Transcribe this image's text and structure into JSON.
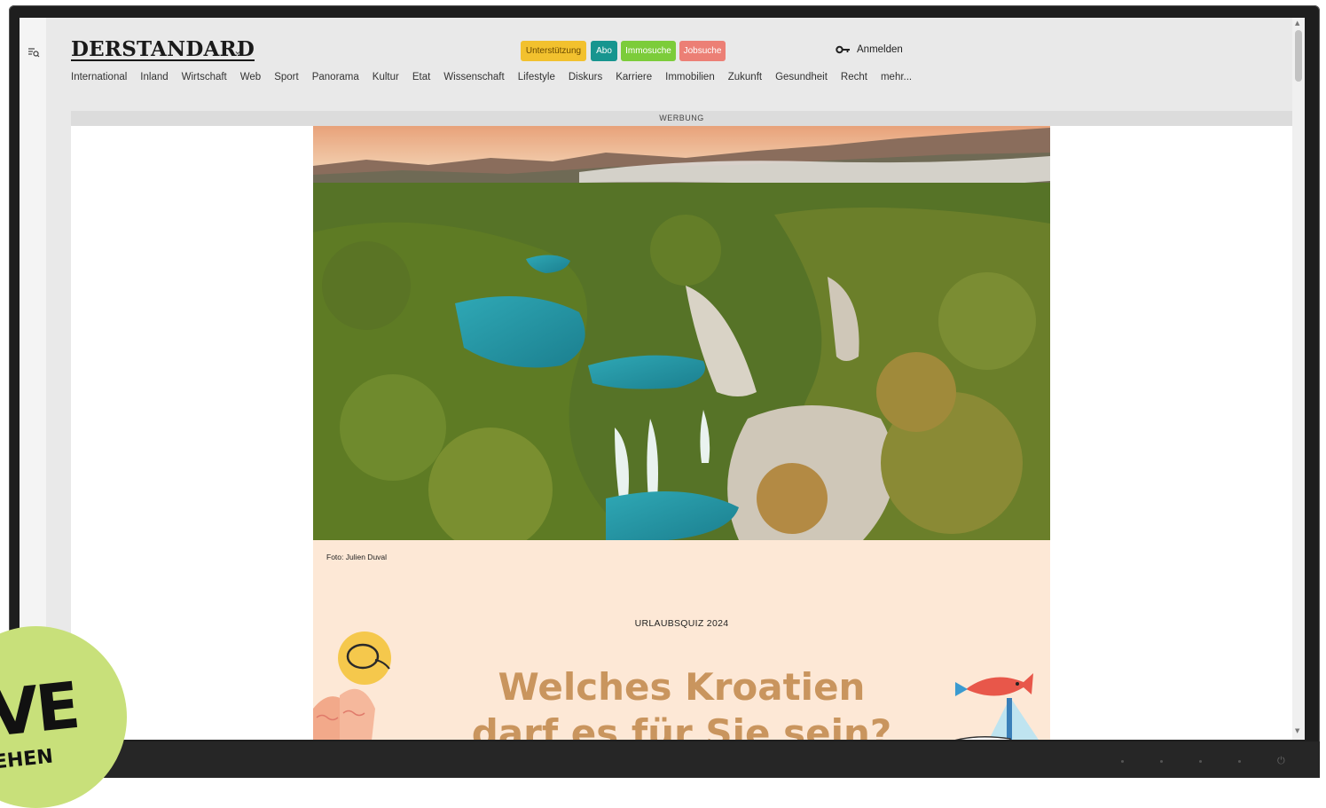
{
  "header": {
    "logo_text": "DERSTANDARD",
    "pills": {
      "support": "Unterstützung",
      "abo": "Abo",
      "immo": "Immosuche",
      "jobs": "Jobsuche"
    },
    "login_label": "Anmelden"
  },
  "nav": {
    "items": [
      "International",
      "Inland",
      "Wirtschaft",
      "Web",
      "Sport",
      "Panorama",
      "Kultur",
      "Etat",
      "Wissenschaft",
      "Lifestyle",
      "Diskurs",
      "Karriere",
      "Immobilien",
      "Zukunft",
      "Gesundheit",
      "Recht",
      "mehr..."
    ]
  },
  "ad": {
    "label": "WERBUNG"
  },
  "article": {
    "photo_caption": "Foto: Julien Duval",
    "kicker": "URLAUBSQUIZ 2024",
    "headline_line1": "Welches Kroatien",
    "headline_line2": "darf es für Sie sein?"
  },
  "badge": {
    "big_text": "VE",
    "small_text": "EHEN"
  },
  "colors": {
    "support": "#f2c12e",
    "abo": "#17958f",
    "immo": "#7ccc3a",
    "jobs": "#ec7f75",
    "headline": "#c9955e",
    "quiz_bg": "#fde8d6",
    "badge": "#c8e07a"
  }
}
